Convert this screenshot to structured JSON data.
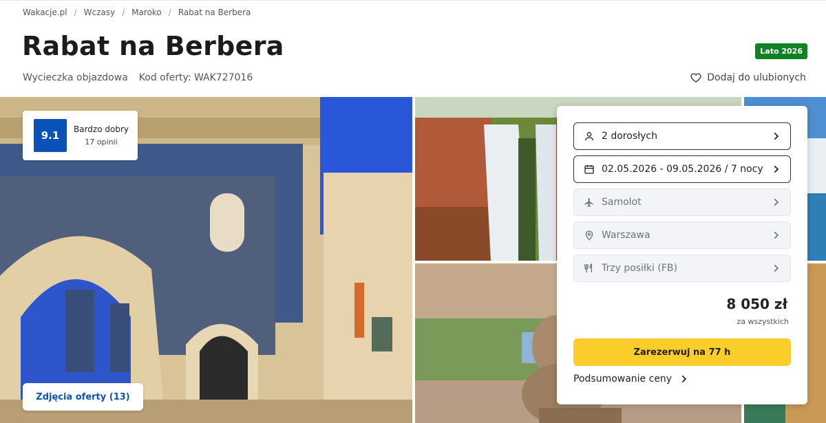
{
  "breadcrumb": [
    "Wakacje.pl",
    "Wczasy",
    "Maroko",
    "Rabat na Berbera"
  ],
  "title": "Rabat na Berbera",
  "season_badge": "Lato 2026",
  "trip_type": "Wycieczka objazdowa",
  "offer_code": "Kod oferty: WAK727016",
  "favorite_label": "Dodaj do ulubionych",
  "rating": {
    "score": "9.1",
    "label": "Bardzo dobry",
    "count": "17 opinii"
  },
  "photos_button": "Zdjęcia oferty (13)",
  "booking": {
    "fields": [
      {
        "icon": "person-icon",
        "value": "2 dorosłych"
      },
      {
        "icon": "calendar-icon",
        "value": "02.05.2026 - 09.05.2026 / 7 nocy"
      },
      {
        "icon": "plane-icon",
        "value": "Samolot"
      },
      {
        "icon": "location-pin-icon",
        "value": "Warszawa"
      },
      {
        "icon": "cutlery-icon",
        "value": "Trzy posiłki (FB)"
      }
    ],
    "price": "8 050 zł",
    "price_note": "za wszystkich",
    "book_button": "Zarezerwuj na 77 h",
    "summary_link": "Podsumowanie ceny"
  },
  "colors": {
    "brand_blue": "#0a51b8",
    "badge_green": "#128126",
    "cta_yellow": "#fbcd2b"
  }
}
